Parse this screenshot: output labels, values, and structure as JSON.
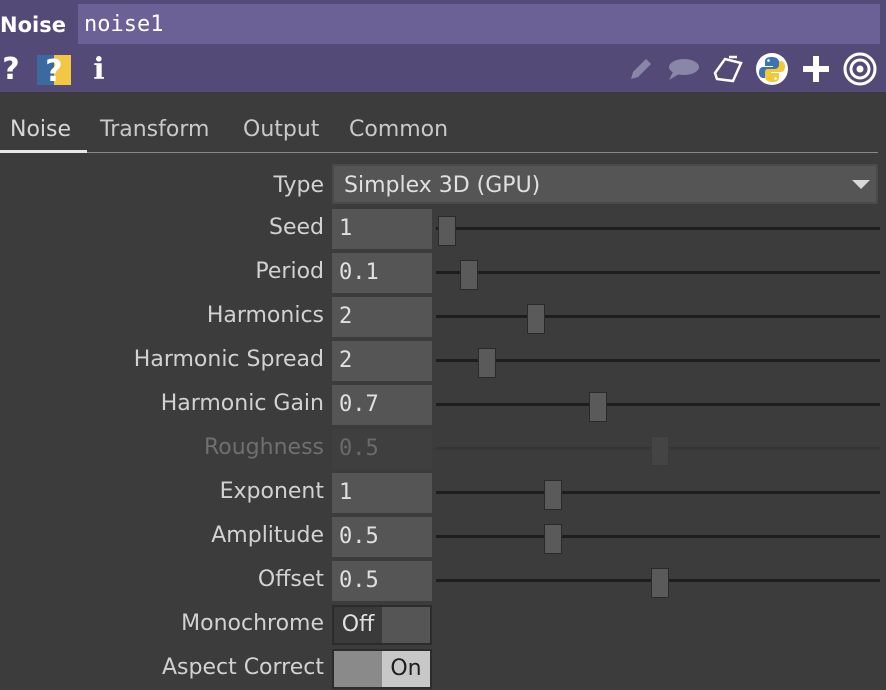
{
  "header": {
    "op_type": "Noise",
    "name": "noise1"
  },
  "tabs": [
    "Noise",
    "Transform",
    "Output",
    "Common"
  ],
  "params": {
    "type": {
      "label": "Type",
      "value": "Simplex 3D (GPU)"
    },
    "seed": {
      "label": "Seed",
      "value": "1",
      "slider_fraction": 0.02
    },
    "period": {
      "label": "Period",
      "value": "0.1",
      "slider_fraction": 0.07
    },
    "harmonics": {
      "label": "Harmonics",
      "value": "2",
      "slider_fraction": 0.22
    },
    "harmonic_spread": {
      "label": "Harmonic Spread",
      "value": "2",
      "slider_fraction": 0.11
    },
    "harmonic_gain": {
      "label": "Harmonic Gain",
      "value": "0.7",
      "slider_fraction": 0.36
    },
    "roughness": {
      "label": "Roughness",
      "value": "0.5",
      "slider_fraction": 0.5
    },
    "exponent": {
      "label": "Exponent",
      "value": "1",
      "slider_fraction": 0.26
    },
    "amplitude": {
      "label": "Amplitude",
      "value": "0.5",
      "slider_fraction": 0.26
    },
    "offset": {
      "label": "Offset",
      "value": "0.5",
      "slider_fraction": 0.5
    },
    "monochrome": {
      "label": "Monochrome",
      "state": "Off",
      "text": "Off"
    },
    "aspect_correct": {
      "label": "Aspect Correct",
      "state": "On",
      "text": "On"
    }
  }
}
